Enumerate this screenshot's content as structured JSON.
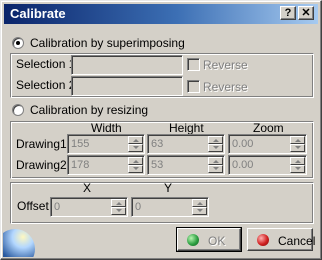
{
  "window": {
    "title": "Calibrate",
    "help_label": "?",
    "close_label": "✕"
  },
  "superimpose": {
    "radio_label": "Calibration by superimposing",
    "selected": true,
    "selection1_label": "Selection 1",
    "selection2_label": "Selection 2",
    "reverse1_label": "Reverse",
    "reverse2_label": "Reverse"
  },
  "resize": {
    "radio_label": "Calibration by resizing",
    "selected": false,
    "col_width": "Width",
    "col_height": "Height",
    "col_zoom": "Zoom",
    "drawing1_label": "Drawing1",
    "drawing2_label": "Drawing2",
    "drawing1": {
      "width": "155",
      "height": "63",
      "zoom": "0.00"
    },
    "drawing2": {
      "width": "178",
      "height": "53",
      "zoom": "0.00"
    }
  },
  "offset": {
    "label": "Offset",
    "x_label": "X",
    "y_label": "Y",
    "x_value": "0",
    "y_value": "0"
  },
  "buttons": {
    "ok_label": "OK",
    "ok_icon": "green-circle-icon",
    "cancel_label": "Cancel",
    "cancel_icon": "red-circle-icon"
  },
  "colors": {
    "title_start": "#0a246a",
    "title_end": "#a6caf0",
    "ok_icon": "#2ea043",
    "cancel_icon": "#d02020"
  }
}
